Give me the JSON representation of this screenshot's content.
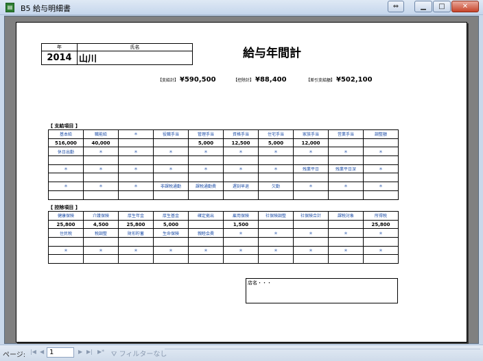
{
  "window": {
    "title": "B5 給与明細書"
  },
  "header": {
    "year_label": "年",
    "name_label": "氏名",
    "year": "2014",
    "name": "山川"
  },
  "report_title": "給与年間計",
  "summary": {
    "pay_total_label": "【支給計】",
    "pay_total": "¥590,500",
    "deduction_total_label": "【控除計】",
    "deduction_total": "¥88,400",
    "net_label": "【差引支給額】",
    "net": "¥502,100"
  },
  "pay_section_label": "【 支給項目 】",
  "pay_rows": [
    [
      "基本給",
      "職能給",
      "＊",
      "役職手当",
      "管理手当",
      "資格手当",
      "住宅手当",
      "家族手当",
      "営業手当",
      "調整額"
    ],
    [
      "516,000",
      "40,000",
      "",
      "",
      "5,000",
      "12,500",
      "5,000",
      "12,000",
      "",
      ""
    ],
    [
      "休日出勤",
      "＊",
      "＊",
      "＊",
      "＊",
      "＊",
      "＊",
      "＊",
      "＊",
      "＊"
    ],
    [
      "",
      "",
      "",
      "",
      "",
      "",
      "",
      "",
      "",
      ""
    ],
    [
      "＊",
      "＊",
      "＊",
      "＊",
      "＊",
      "＊",
      "＊",
      "残業平日",
      "残業平日深",
      "＊"
    ],
    [
      "",
      "",
      "",
      "",
      "",
      "",
      "",
      "",
      "",
      ""
    ],
    [
      "＊",
      "＊",
      "＊",
      "非課税通勤",
      "課税通勤費",
      "遅刻早退",
      "欠勤",
      "＊",
      "＊",
      "＊"
    ],
    [
      "",
      "",
      "",
      "",
      "",
      "",
      "",
      "",
      "",
      ""
    ]
  ],
  "deduction_section_label": "【 控除項目 】",
  "deduction_rows": [
    [
      "健康保険",
      "介護保険",
      "厚生年金",
      "厚生基金",
      "確定拠出",
      "雇用保険",
      "社保険調整",
      "社保険合計",
      "課税対象",
      "所得税"
    ],
    [
      "25,800",
      "4,500",
      "25,800",
      "5,000",
      "",
      "1,500",
      "",
      "",
      "",
      "25,800"
    ],
    [
      "住民税",
      "税調整",
      "財形貯蓄",
      "生命保険",
      "親睦会費",
      "＊",
      "＊",
      "＊",
      "＊",
      "＊"
    ],
    [
      "",
      "",
      "",
      "",
      "",
      "",
      "",
      "",
      "",
      ""
    ],
    [
      "＊",
      "＊",
      "＊",
      "＊",
      "＊",
      "＊",
      "＊",
      "＊",
      "＊",
      "＊"
    ],
    [
      "",
      "",
      "",
      "",
      "",
      "",
      "",
      "",
      "",
      ""
    ]
  ],
  "store_label": "店名・・・",
  "statusbar": {
    "page_label": "ページ:",
    "page_value": "1",
    "filter_label": "フィルターなし"
  }
}
